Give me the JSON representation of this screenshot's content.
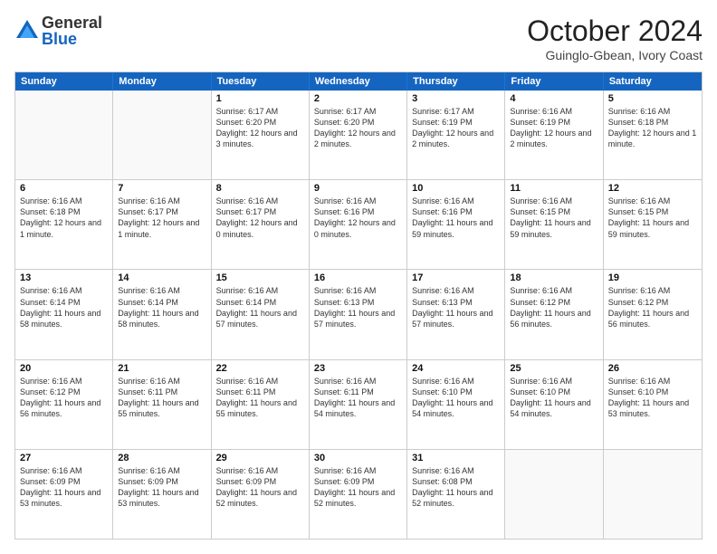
{
  "header": {
    "logo_general": "General",
    "logo_blue": "Blue",
    "month_title": "October 2024",
    "location": "Guinglo-Gbean, Ivory Coast"
  },
  "weekdays": [
    "Sunday",
    "Monday",
    "Tuesday",
    "Wednesday",
    "Thursday",
    "Friday",
    "Saturday"
  ],
  "rows": [
    [
      {
        "day": "",
        "text": "",
        "empty": true
      },
      {
        "day": "",
        "text": "",
        "empty": true
      },
      {
        "day": "1",
        "text": "Sunrise: 6:17 AM\nSunset: 6:20 PM\nDaylight: 12 hours and 3 minutes."
      },
      {
        "day": "2",
        "text": "Sunrise: 6:17 AM\nSunset: 6:20 PM\nDaylight: 12 hours and 2 minutes."
      },
      {
        "day": "3",
        "text": "Sunrise: 6:17 AM\nSunset: 6:19 PM\nDaylight: 12 hours and 2 minutes."
      },
      {
        "day": "4",
        "text": "Sunrise: 6:16 AM\nSunset: 6:19 PM\nDaylight: 12 hours and 2 minutes."
      },
      {
        "day": "5",
        "text": "Sunrise: 6:16 AM\nSunset: 6:18 PM\nDaylight: 12 hours and 1 minute."
      }
    ],
    [
      {
        "day": "6",
        "text": "Sunrise: 6:16 AM\nSunset: 6:18 PM\nDaylight: 12 hours and 1 minute."
      },
      {
        "day": "7",
        "text": "Sunrise: 6:16 AM\nSunset: 6:17 PM\nDaylight: 12 hours and 1 minute."
      },
      {
        "day": "8",
        "text": "Sunrise: 6:16 AM\nSunset: 6:17 PM\nDaylight: 12 hours and 0 minutes."
      },
      {
        "day": "9",
        "text": "Sunrise: 6:16 AM\nSunset: 6:16 PM\nDaylight: 12 hours and 0 minutes."
      },
      {
        "day": "10",
        "text": "Sunrise: 6:16 AM\nSunset: 6:16 PM\nDaylight: 11 hours and 59 minutes."
      },
      {
        "day": "11",
        "text": "Sunrise: 6:16 AM\nSunset: 6:15 PM\nDaylight: 11 hours and 59 minutes."
      },
      {
        "day": "12",
        "text": "Sunrise: 6:16 AM\nSunset: 6:15 PM\nDaylight: 11 hours and 59 minutes."
      }
    ],
    [
      {
        "day": "13",
        "text": "Sunrise: 6:16 AM\nSunset: 6:14 PM\nDaylight: 11 hours and 58 minutes."
      },
      {
        "day": "14",
        "text": "Sunrise: 6:16 AM\nSunset: 6:14 PM\nDaylight: 11 hours and 58 minutes."
      },
      {
        "day": "15",
        "text": "Sunrise: 6:16 AM\nSunset: 6:14 PM\nDaylight: 11 hours and 57 minutes."
      },
      {
        "day": "16",
        "text": "Sunrise: 6:16 AM\nSunset: 6:13 PM\nDaylight: 11 hours and 57 minutes."
      },
      {
        "day": "17",
        "text": "Sunrise: 6:16 AM\nSunset: 6:13 PM\nDaylight: 11 hours and 57 minutes."
      },
      {
        "day": "18",
        "text": "Sunrise: 6:16 AM\nSunset: 6:12 PM\nDaylight: 11 hours and 56 minutes."
      },
      {
        "day": "19",
        "text": "Sunrise: 6:16 AM\nSunset: 6:12 PM\nDaylight: 11 hours and 56 minutes."
      }
    ],
    [
      {
        "day": "20",
        "text": "Sunrise: 6:16 AM\nSunset: 6:12 PM\nDaylight: 11 hours and 56 minutes."
      },
      {
        "day": "21",
        "text": "Sunrise: 6:16 AM\nSunset: 6:11 PM\nDaylight: 11 hours and 55 minutes."
      },
      {
        "day": "22",
        "text": "Sunrise: 6:16 AM\nSunset: 6:11 PM\nDaylight: 11 hours and 55 minutes."
      },
      {
        "day": "23",
        "text": "Sunrise: 6:16 AM\nSunset: 6:11 PM\nDaylight: 11 hours and 54 minutes."
      },
      {
        "day": "24",
        "text": "Sunrise: 6:16 AM\nSunset: 6:10 PM\nDaylight: 11 hours and 54 minutes."
      },
      {
        "day": "25",
        "text": "Sunrise: 6:16 AM\nSunset: 6:10 PM\nDaylight: 11 hours and 54 minutes."
      },
      {
        "day": "26",
        "text": "Sunrise: 6:16 AM\nSunset: 6:10 PM\nDaylight: 11 hours and 53 minutes."
      }
    ],
    [
      {
        "day": "27",
        "text": "Sunrise: 6:16 AM\nSunset: 6:09 PM\nDaylight: 11 hours and 53 minutes."
      },
      {
        "day": "28",
        "text": "Sunrise: 6:16 AM\nSunset: 6:09 PM\nDaylight: 11 hours and 53 minutes."
      },
      {
        "day": "29",
        "text": "Sunrise: 6:16 AM\nSunset: 6:09 PM\nDaylight: 11 hours and 52 minutes."
      },
      {
        "day": "30",
        "text": "Sunrise: 6:16 AM\nSunset: 6:09 PM\nDaylight: 11 hours and 52 minutes."
      },
      {
        "day": "31",
        "text": "Sunrise: 6:16 AM\nSunset: 6:08 PM\nDaylight: 11 hours and 52 minutes."
      },
      {
        "day": "",
        "text": "",
        "empty": true
      },
      {
        "day": "",
        "text": "",
        "empty": true
      }
    ]
  ]
}
